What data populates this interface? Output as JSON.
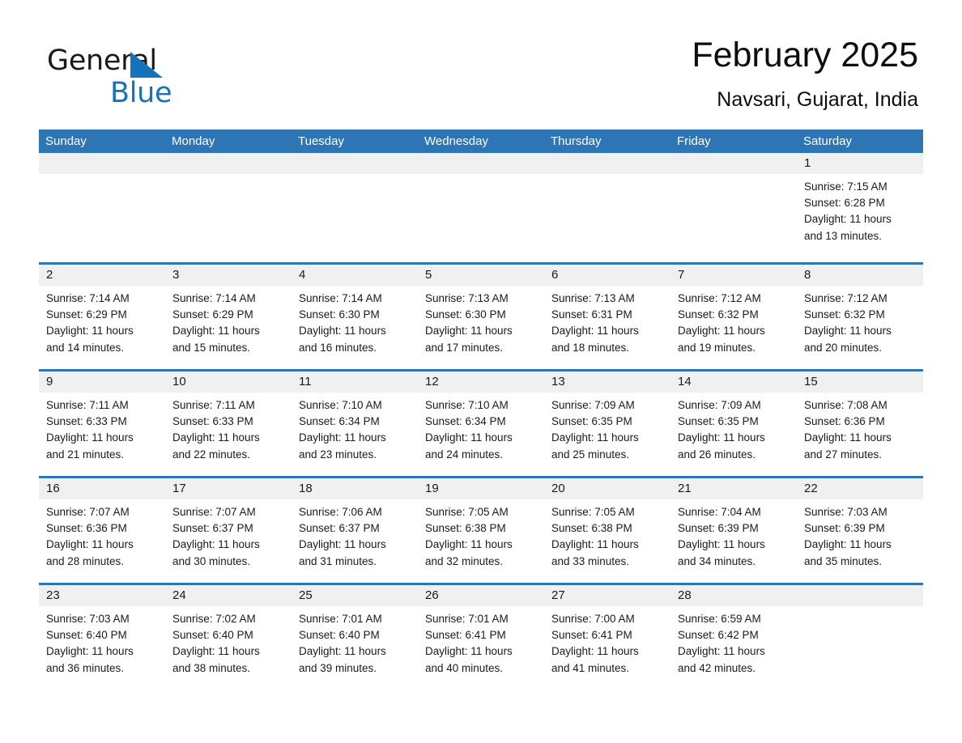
{
  "logo": {
    "word1": "General",
    "word2": "Blue",
    "triangle_color": "#1573BE",
    "text_color": "#1a1a1a"
  },
  "header": {
    "title": "February 2025",
    "subtitle": "Navsari, Gujarat, India"
  },
  "theme": {
    "accent": "#2E75B6",
    "day_header_bg": "#f0f0f0",
    "page_bg": "#ffffff",
    "text": "#1a1a1a"
  },
  "calendar": {
    "weekday_headers": [
      "Sunday",
      "Monday",
      "Tuesday",
      "Wednesday",
      "Thursday",
      "Friday",
      "Saturday"
    ],
    "weeks": [
      [
        {
          "empty": true
        },
        {
          "empty": true
        },
        {
          "empty": true
        },
        {
          "empty": true
        },
        {
          "empty": true
        },
        {
          "empty": true
        },
        {
          "day": "1",
          "sunrise": "Sunrise: 7:15 AM",
          "sunset": "Sunset: 6:28 PM",
          "daylight1": "Daylight: 11 hours",
          "daylight2": "and 13 minutes."
        }
      ],
      [
        {
          "day": "2",
          "sunrise": "Sunrise: 7:14 AM",
          "sunset": "Sunset: 6:29 PM",
          "daylight1": "Daylight: 11 hours",
          "daylight2": "and 14 minutes."
        },
        {
          "day": "3",
          "sunrise": "Sunrise: 7:14 AM",
          "sunset": "Sunset: 6:29 PM",
          "daylight1": "Daylight: 11 hours",
          "daylight2": "and 15 minutes."
        },
        {
          "day": "4",
          "sunrise": "Sunrise: 7:14 AM",
          "sunset": "Sunset: 6:30 PM",
          "daylight1": "Daylight: 11 hours",
          "daylight2": "and 16 minutes."
        },
        {
          "day": "5",
          "sunrise": "Sunrise: 7:13 AM",
          "sunset": "Sunset: 6:30 PM",
          "daylight1": "Daylight: 11 hours",
          "daylight2": "and 17 minutes."
        },
        {
          "day": "6",
          "sunrise": "Sunrise: 7:13 AM",
          "sunset": "Sunset: 6:31 PM",
          "daylight1": "Daylight: 11 hours",
          "daylight2": "and 18 minutes."
        },
        {
          "day": "7",
          "sunrise": "Sunrise: 7:12 AM",
          "sunset": "Sunset: 6:32 PM",
          "daylight1": "Daylight: 11 hours",
          "daylight2": "and 19 minutes."
        },
        {
          "day": "8",
          "sunrise": "Sunrise: 7:12 AM",
          "sunset": "Sunset: 6:32 PM",
          "daylight1": "Daylight: 11 hours",
          "daylight2": "and 20 minutes."
        }
      ],
      [
        {
          "day": "9",
          "sunrise": "Sunrise: 7:11 AM",
          "sunset": "Sunset: 6:33 PM",
          "daylight1": "Daylight: 11 hours",
          "daylight2": "and 21 minutes."
        },
        {
          "day": "10",
          "sunrise": "Sunrise: 7:11 AM",
          "sunset": "Sunset: 6:33 PM",
          "daylight1": "Daylight: 11 hours",
          "daylight2": "and 22 minutes."
        },
        {
          "day": "11",
          "sunrise": "Sunrise: 7:10 AM",
          "sunset": "Sunset: 6:34 PM",
          "daylight1": "Daylight: 11 hours",
          "daylight2": "and 23 minutes."
        },
        {
          "day": "12",
          "sunrise": "Sunrise: 7:10 AM",
          "sunset": "Sunset: 6:34 PM",
          "daylight1": "Daylight: 11 hours",
          "daylight2": "and 24 minutes."
        },
        {
          "day": "13",
          "sunrise": "Sunrise: 7:09 AM",
          "sunset": "Sunset: 6:35 PM",
          "daylight1": "Daylight: 11 hours",
          "daylight2": "and 25 minutes."
        },
        {
          "day": "14",
          "sunrise": "Sunrise: 7:09 AM",
          "sunset": "Sunset: 6:35 PM",
          "daylight1": "Daylight: 11 hours",
          "daylight2": "and 26 minutes."
        },
        {
          "day": "15",
          "sunrise": "Sunrise: 7:08 AM",
          "sunset": "Sunset: 6:36 PM",
          "daylight1": "Daylight: 11 hours",
          "daylight2": "and 27 minutes."
        }
      ],
      [
        {
          "day": "16",
          "sunrise": "Sunrise: 7:07 AM",
          "sunset": "Sunset: 6:36 PM",
          "daylight1": "Daylight: 11 hours",
          "daylight2": "and 28 minutes."
        },
        {
          "day": "17",
          "sunrise": "Sunrise: 7:07 AM",
          "sunset": "Sunset: 6:37 PM",
          "daylight1": "Daylight: 11 hours",
          "daylight2": "and 30 minutes."
        },
        {
          "day": "18",
          "sunrise": "Sunrise: 7:06 AM",
          "sunset": "Sunset: 6:37 PM",
          "daylight1": "Daylight: 11 hours",
          "daylight2": "and 31 minutes."
        },
        {
          "day": "19",
          "sunrise": "Sunrise: 7:05 AM",
          "sunset": "Sunset: 6:38 PM",
          "daylight1": "Daylight: 11 hours",
          "daylight2": "and 32 minutes."
        },
        {
          "day": "20",
          "sunrise": "Sunrise: 7:05 AM",
          "sunset": "Sunset: 6:38 PM",
          "daylight1": "Daylight: 11 hours",
          "daylight2": "and 33 minutes."
        },
        {
          "day": "21",
          "sunrise": "Sunrise: 7:04 AM",
          "sunset": "Sunset: 6:39 PM",
          "daylight1": "Daylight: 11 hours",
          "daylight2": "and 34 minutes."
        },
        {
          "day": "22",
          "sunrise": "Sunrise: 7:03 AM",
          "sunset": "Sunset: 6:39 PM",
          "daylight1": "Daylight: 11 hours",
          "daylight2": "and 35 minutes."
        }
      ],
      [
        {
          "day": "23",
          "sunrise": "Sunrise: 7:03 AM",
          "sunset": "Sunset: 6:40 PM",
          "daylight1": "Daylight: 11 hours",
          "daylight2": "and 36 minutes."
        },
        {
          "day": "24",
          "sunrise": "Sunrise: 7:02 AM",
          "sunset": "Sunset: 6:40 PM",
          "daylight1": "Daylight: 11 hours",
          "daylight2": "and 38 minutes."
        },
        {
          "day": "25",
          "sunrise": "Sunrise: 7:01 AM",
          "sunset": "Sunset: 6:40 PM",
          "daylight1": "Daylight: 11 hours",
          "daylight2": "and 39 minutes."
        },
        {
          "day": "26",
          "sunrise": "Sunrise: 7:01 AM",
          "sunset": "Sunset: 6:41 PM",
          "daylight1": "Daylight: 11 hours",
          "daylight2": "and 40 minutes."
        },
        {
          "day": "27",
          "sunrise": "Sunrise: 7:00 AM",
          "sunset": "Sunset: 6:41 PM",
          "daylight1": "Daylight: 11 hours",
          "daylight2": "and 41 minutes."
        },
        {
          "day": "28",
          "sunrise": "Sunrise: 6:59 AM",
          "sunset": "Sunset: 6:42 PM",
          "daylight1": "Daylight: 11 hours",
          "daylight2": "and 42 minutes."
        },
        {
          "empty": true
        }
      ]
    ]
  }
}
